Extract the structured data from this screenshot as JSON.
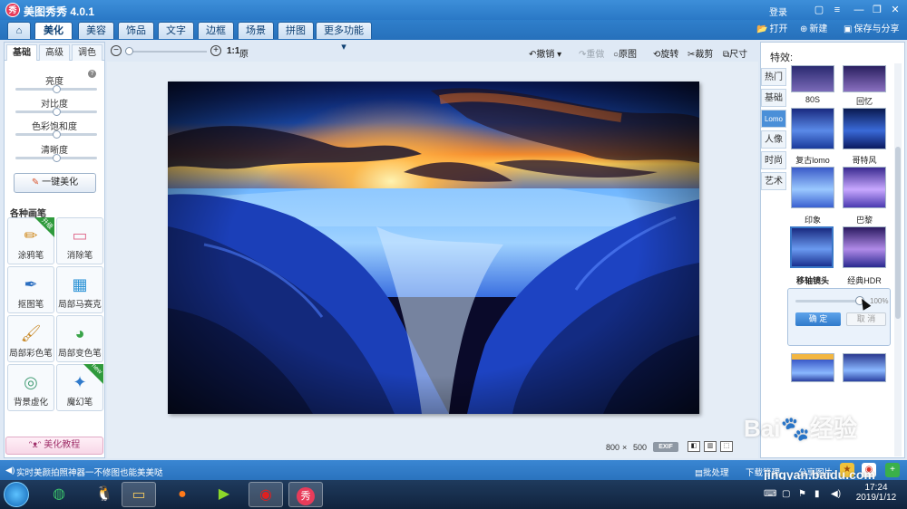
{
  "app": {
    "title": "美图秀秀 4.0.1",
    "logo": "秀",
    "login": "登录"
  },
  "menu": {
    "tabs": [
      "美化",
      "美容",
      "饰品",
      "文字",
      "边框",
      "场景",
      "拼图",
      "更多功能 ▾"
    ],
    "open": "打开",
    "new": "新建",
    "save_share": "保存与分享"
  },
  "left": {
    "subtabs": [
      "基础",
      "高级",
      "调色"
    ],
    "sliders": [
      {
        "label": "亮度",
        "value": 0.5
      },
      {
        "label": "对比度",
        "value": 0.5
      },
      {
        "label": "色彩饱和度",
        "value": 0.5
      },
      {
        "label": "清晰度",
        "value": 0.5
      }
    ],
    "one_key": "一键美化",
    "brushes_title": "各种画笔",
    "brushes": [
      {
        "label": "涂鸦笔",
        "badge": "升级"
      },
      {
        "label": "消除笔",
        "badge": ""
      },
      {
        "label": "抠图笔",
        "badge": ""
      },
      {
        "label": "局部马赛克",
        "badge": ""
      },
      {
        "label": "局部彩色笔",
        "badge": ""
      },
      {
        "label": "局部变色笔",
        "badge": ""
      },
      {
        "label": "背景虚化",
        "badge": ""
      },
      {
        "label": "魔幻笔",
        "badge": "new"
      }
    ],
    "tutorial": "美化教程"
  },
  "toolbar": {
    "zoom_ratio": "1:1",
    "zoom_original": "原大",
    "undo": "撤销",
    "redo": "重做",
    "original": "原图",
    "rotate": "旋转",
    "crop": "裁剪",
    "size": "尺寸"
  },
  "canvas": {
    "width": "800",
    "sep": "×",
    "height": "500",
    "exif": "EXIF"
  },
  "effects": {
    "title": "特效:",
    "categories": [
      "热门",
      "基础",
      "Lomo",
      "人像",
      "时尚",
      "艺术"
    ],
    "active_category": "Lomo",
    "items": [
      "80S",
      "回忆",
      "复古lomo",
      "哥特风",
      "印象",
      "巴黎",
      "移轴镜头",
      "经典HDR"
    ],
    "selected": "移轴镜头",
    "strength": "100%",
    "strength_value": 1.0,
    "ok": "确 定",
    "cancel": "取 消"
  },
  "status": {
    "promo": "实时美颜拍照神器一不修图也能美美哒",
    "batch": "批处理",
    "download": "下载管理",
    "share": "分享图片"
  },
  "taskbar": {
    "time": "17:24",
    "date": "2019/1/12",
    "app_label": "秀"
  },
  "watermark": {
    "logo": "Bai🐾经验",
    "url": "jingyan.baidu.com"
  },
  "colors": {
    "accent": "#2a78c6",
    "selection": "#3a78c8"
  }
}
